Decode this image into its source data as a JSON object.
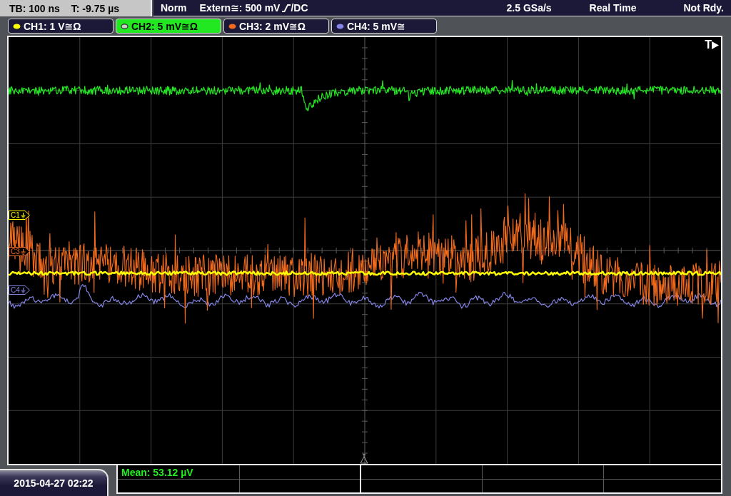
{
  "status_bar": {
    "timebase": "TB: 100 ns",
    "trigger_time": "T: -9.75 µs",
    "trigger_mode": "Norm",
    "trigger_source": "Extern≅: 500 mV",
    "trigger_coupling": "/DC",
    "sample_rate": "2.5 GSa/s",
    "acquisition": "Real Time",
    "run_state": "Not Rdy."
  },
  "channels": [
    {
      "label": "CH1: 1 V≅Ω",
      "color": "#ffff00",
      "selected": false,
      "marker": "C1"
    },
    {
      "label": "CH2: 5 mV≅Ω",
      "color": "#22e822",
      "selected": true
    },
    {
      "label": "CH3: 2 mV≅Ω",
      "color": "#f26b1d",
      "selected": false,
      "marker": "C3"
    },
    {
      "label": "CH4: 5 mV≅",
      "color": "#8585e8",
      "selected": false,
      "marker": "C4"
    }
  ],
  "plot": {
    "trigger_marker": "T"
  },
  "measurements": [
    {
      "text": "Mean: 53.12 µV"
    }
  ],
  "date_time": "2015-04-27 02:22"
}
